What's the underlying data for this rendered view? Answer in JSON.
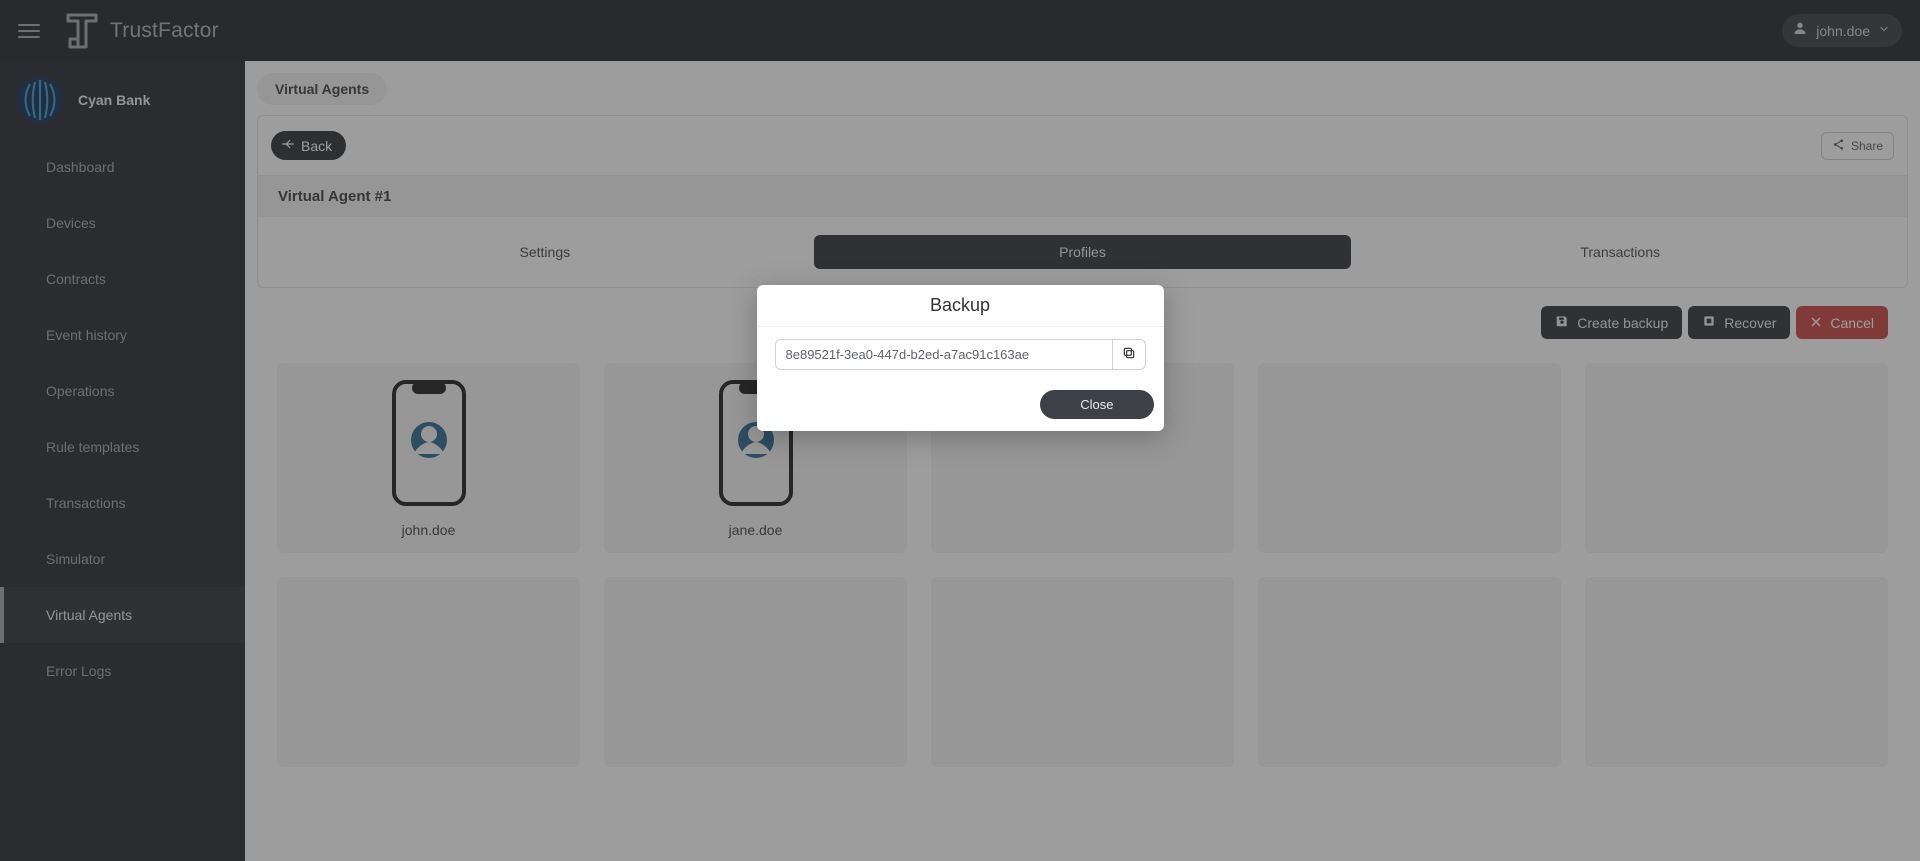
{
  "header": {
    "app_name": "TrustFactor",
    "user_name": "john.doe"
  },
  "sidebar": {
    "org_name": "Cyan Bank",
    "items": [
      {
        "label": "Dashboard"
      },
      {
        "label": "Devices"
      },
      {
        "label": "Contracts"
      },
      {
        "label": "Event history"
      },
      {
        "label": "Operations"
      },
      {
        "label": "Rule templates"
      },
      {
        "label": "Transactions"
      },
      {
        "label": "Simulator"
      },
      {
        "label": "Virtual Agents",
        "active": true
      },
      {
        "label": "Error Logs"
      }
    ]
  },
  "main": {
    "breadcrumb": "Virtual Agents",
    "back_label": "Back",
    "share_label": "Share",
    "agent_title": "Virtual Agent #1",
    "tabs": {
      "settings": "Settings",
      "profiles": "Profiles",
      "transactions": "Transactions"
    },
    "actions": {
      "create_backup": "Create backup",
      "recover": "Recover",
      "cancel": "Cancel"
    },
    "cards": [
      {
        "label": "john.doe"
      },
      {
        "label": "jane.doe"
      }
    ]
  },
  "modal": {
    "title": "Backup",
    "value": "8e89521f-3ea0-447d-b2ed-a7ac91c163ae",
    "close_label": "Close"
  }
}
